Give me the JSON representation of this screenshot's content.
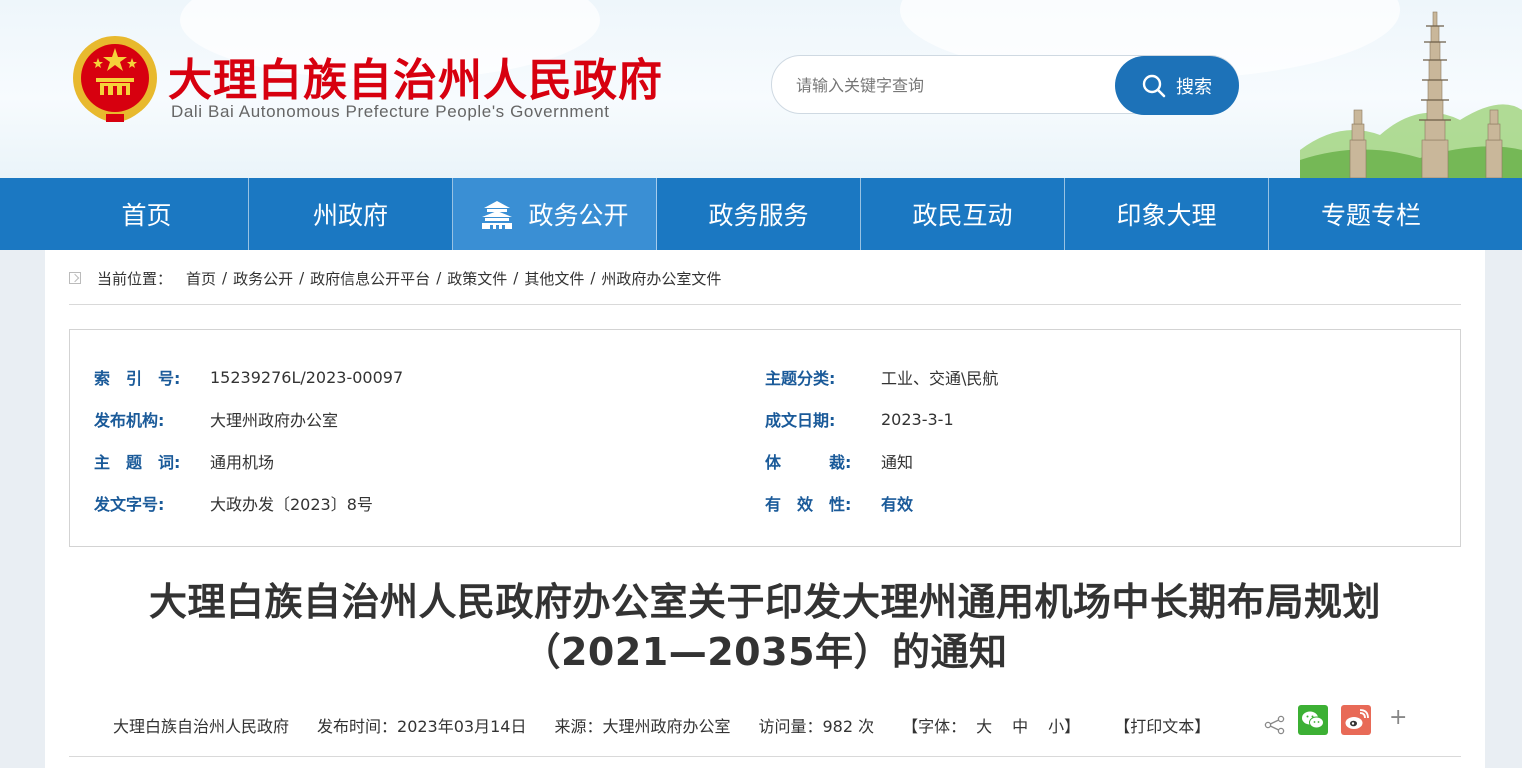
{
  "header": {
    "title": "大理白族自治州人民政府",
    "subtitle": "Dali Bai Autonomous Prefecture People's Government",
    "search_placeholder": "请输入关键字查询",
    "search_button": "搜索",
    "title_color": "#d7000f"
  },
  "nav": {
    "items": [
      {
        "label": "首页"
      },
      {
        "label": "州政府"
      },
      {
        "label": "政务公开",
        "active": true,
        "icon": "tiananmen-icon"
      },
      {
        "label": "政务服务"
      },
      {
        "label": "政民互动"
      },
      {
        "label": "印象大理"
      },
      {
        "label": "专题专栏"
      }
    ],
    "bg_color": "#1b78c2",
    "active_color": "#3a8fd4"
  },
  "breadcrumb": {
    "label": "当前位置：",
    "items": [
      "首页",
      "政务公开",
      "政府信息公开平台",
      "政策文件",
      "其他文件",
      "州政府办公室文件"
    ]
  },
  "meta": {
    "index_key": "索　引　号:",
    "index_val": "15239276L/2023-00097",
    "category_key": "主题分类:",
    "category_val": "工业、交通\\民航",
    "publisher_key": "发布机构:",
    "publisher_val": "大理州政府办公室",
    "date_key": "成文日期:",
    "date_val": "2023-3-1",
    "keyword_key": "主　题　词:",
    "keyword_val": "通用机场",
    "genre_key": "体　　　裁:",
    "genre_val": "通知",
    "docno_key": "发文字号:",
    "docno_val": "大政办发〔2023〕8号",
    "validity_key": "有　效　性:",
    "validity_val": "有效"
  },
  "document": {
    "title_line1": "大理白族自治州人民政府办公室关于印发大理州通用机场中长期布局规划",
    "title_line2": "（2021—2035年）的通知"
  },
  "info": {
    "org": "大理白族自治州人民政府",
    "publish_time": "发布时间：2023年03月14日",
    "source": "来源：大理州政府办公室",
    "views": "访问量：982 次",
    "font_label": "【字体：",
    "font_large": "大",
    "font_medium": "中",
    "font_small": "小】",
    "print": "【打印文本】",
    "plus": "+"
  }
}
